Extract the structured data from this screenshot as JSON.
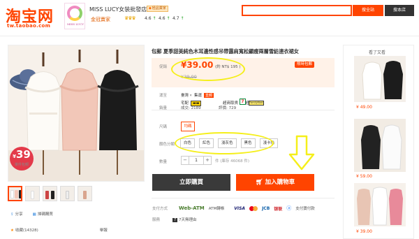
{
  "header": {
    "logo": "淘宝网",
    "logo_sub": "tw.taobao.com",
    "shop_logo_brand": "MISS LUCY",
    "shop_name": "MISS LUCY女装批發店",
    "shop_badge": "極品賣家",
    "seller_level": "金冠賣家",
    "stars": "♛♛♛",
    "ratings": [
      "4.6",
      "4.6",
      "4.7"
    ],
    "search_all_label": "搜全站",
    "search_shop_label": "搜本店"
  },
  "product": {
    "title": "包郵 夏季甜美純色木耳邊性感吊帶露肩寬松顯瘦兩層雪紡連衣裙女",
    "price_label": "促銷",
    "price": "¥39.00",
    "price_ntd": "(約 NT$ 195 )",
    "promo_badge": "限時包郵",
    "original_price": "¥39.00",
    "ship_label": "運至",
    "ship_to": "臺灣",
    "ship_method": "集運",
    "ship_tag": "直郵",
    "ship_option1": "宅配",
    "ship_option2": "超商取貨",
    "ship_option2_note": "超值集運",
    "sales_label": "銷量",
    "sales": "成交: 2189",
    "reviews": "評價: 729",
    "main_price_circle": "39",
    "main_price_circle_label": "單件包郵",
    "size_label": "尺碼",
    "size_value": "均碼",
    "color_label": "顏色分類",
    "colors": [
      "白色",
      "紅色",
      "淺灰色",
      "黑色",
      "淺卡色"
    ],
    "qty_label": "數量",
    "qty_value": "1",
    "stock": "件 (庫存 46068 件)",
    "buy_now": "立即購買",
    "add_to_cart": "加入購物車"
  },
  "share": {
    "share_label": "分享",
    "qr_label": "掃碼購買",
    "fav_label": "收藏(14328)",
    "report_label": "舉報"
  },
  "payment": {
    "label": "支付方式",
    "webatm": "Web-ATM",
    "atm": "ATM轉帳",
    "visa": "VISA",
    "jcb": "JCB",
    "cup": "银联",
    "alipay": "支付寶付款"
  },
  "service": {
    "label": "服務",
    "return": "7天無理由"
  },
  "sidebar": {
    "title": "看了又看",
    "items": [
      {
        "price": "¥ 49.00"
      },
      {
        "price": "¥ 59.00"
      },
      {
        "price": "¥ 39.00"
      }
    ]
  },
  "colors": {
    "accent": "#ff4400",
    "highlight_oval": "#f5ef1a"
  }
}
